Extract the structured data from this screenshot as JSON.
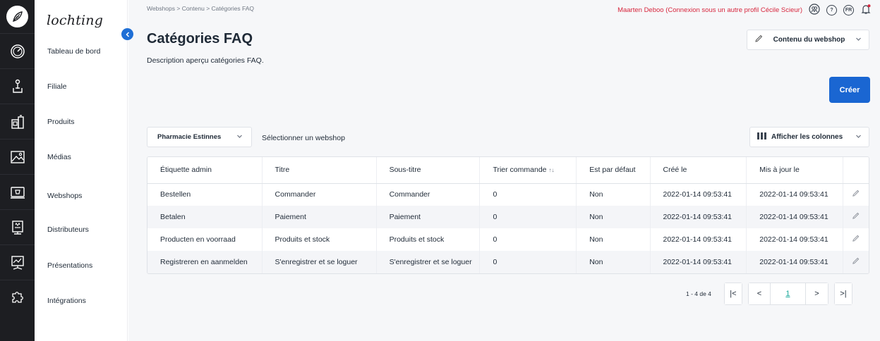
{
  "brand": {
    "name": "lochting"
  },
  "sidebar": {
    "items": [
      {
        "label": "Tableau de bord",
        "icon": "dashboard-gauge-icon"
      },
      {
        "label": "Filiale",
        "icon": "location-pin-icon"
      },
      {
        "label": "Produits",
        "icon": "products-icon"
      },
      {
        "label": "Médias",
        "icon": "media-image-icon"
      },
      {
        "label": "Webshops",
        "icon": "webshop-icon"
      },
      {
        "label": "Distributeurs",
        "icon": "distributor-icon"
      },
      {
        "label": "Présentations",
        "icon": "presentation-icon"
      },
      {
        "label": "Intégrations",
        "icon": "integrations-puzzle-icon"
      }
    ]
  },
  "breadcrumb": {
    "text": "Webshops > Contenu > Catégories FAQ"
  },
  "topbar": {
    "user_text": "Maarten Deboo (Connexion sous un autre profil Cécile Scieur)",
    "help": "?",
    "lang": "FR",
    "user_color": "#d7263d"
  },
  "page": {
    "title": "Catégories FAQ",
    "description": "Description aperçu catégories FAQ."
  },
  "content_menu": {
    "label": "Contenu du webshop"
  },
  "create_button": {
    "label": "Créer",
    "color": "#1a66d2"
  },
  "filter": {
    "selected_value": "Pharmacie Estinnes",
    "label": "Sélectionner un webshop"
  },
  "columns_button": {
    "label": "Afficher les colonnes"
  },
  "table": {
    "headers": [
      "Étiquette admin",
      "Titre",
      "Sous-titre",
      "Trier commande",
      "Est par défaut",
      "Créé le",
      "Mis à jour le"
    ],
    "rows": [
      [
        "Bestellen",
        "Commander",
        "Commander",
        "0",
        "Non",
        "2022-01-14 09:53:41",
        "2022-01-14 09:53:41"
      ],
      [
        "Betalen",
        "Paiement",
        "Paiement",
        "0",
        "Non",
        "2022-01-14 09:53:41",
        "2022-01-14 09:53:41"
      ],
      [
        "Producten en voorraad",
        "Produits et stock",
        "Produits et stock",
        "0",
        "Non",
        "2022-01-14 09:53:41",
        "2022-01-14 09:53:41"
      ],
      [
        "Registreren en aanmelden",
        "S'enregistrer et se loguer",
        "S'enregistrer et se loguer",
        "0",
        "Non",
        "2022-01-14 09:53:41",
        "2022-01-14 09:53:41"
      ]
    ]
  },
  "pagination": {
    "info": "1 - 4 de 4",
    "current_page": "1",
    "first": "|<",
    "prev": "<",
    "next": ">",
    "last": ">|",
    "current_color": "#19a89a"
  }
}
